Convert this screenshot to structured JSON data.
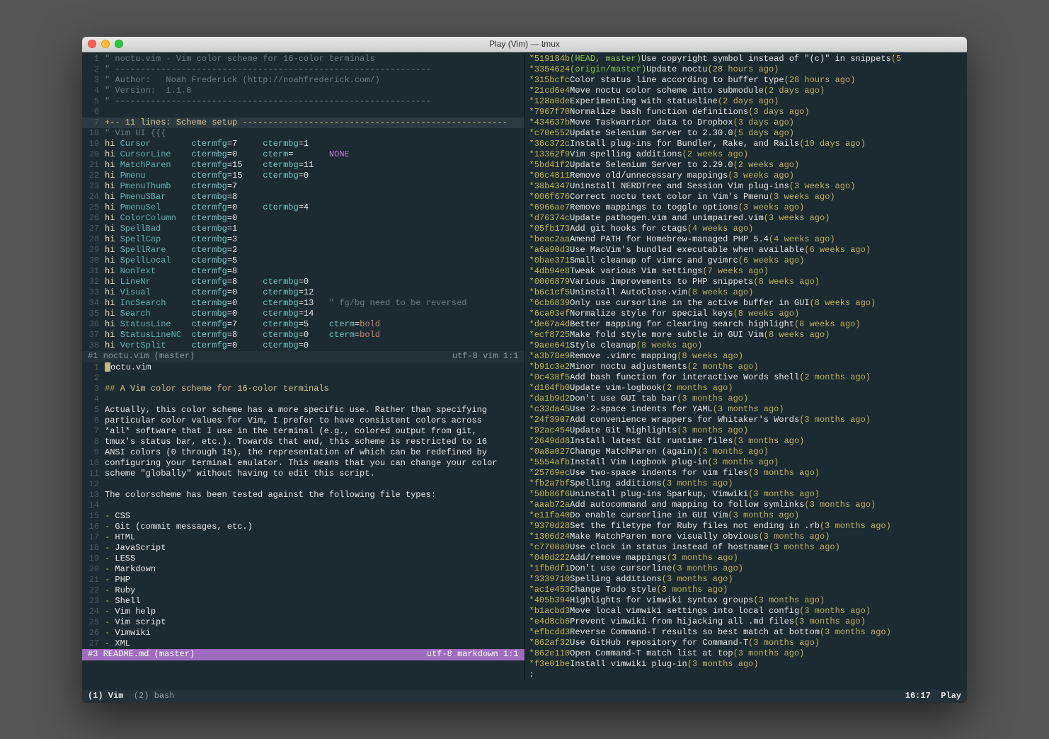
{
  "window_title": "Play (Vim) — tmux",
  "vim_top": {
    "header_lines": [
      {
        "n": "1",
        "comment": "\" noctu.vim - Vim color scheme for 16-color terminals"
      },
      {
        "n": "2",
        "comment": "\" --------------------------------------------------------------"
      },
      {
        "n": "3",
        "comment": "\" Author:   Noah Frederick (http://noahfrederick.com/)"
      },
      {
        "n": "4",
        "comment": "\" Version:  1.1.0"
      },
      {
        "n": "5",
        "comment": "\" --------------------------------------------------------------"
      },
      {
        "n": "6",
        "comment": ""
      }
    ],
    "fold": {
      "n": "7",
      "text": "+-- 11 lines: Scheme setup ----------------------------------------------------"
    },
    "section": {
      "n": "18",
      "text": "\" Vim UI {{{"
    },
    "hi_lines": [
      {
        "n": "19",
        "name": "Cursor",
        "a": "ctermfg=7",
        "b": "ctermbg=1",
        "c": ""
      },
      {
        "n": "20",
        "name": "CursorLine",
        "a": "ctermbg=0",
        "b": "cterm=",
        "c": "NONE"
      },
      {
        "n": "21",
        "name": "MatchParen",
        "a": "ctermfg=15",
        "b": "ctermbg=11",
        "c": ""
      },
      {
        "n": "22",
        "name": "Pmenu",
        "a": "ctermfg=15",
        "b": "ctermbg=0",
        "c": ""
      },
      {
        "n": "23",
        "name": "PmenuThumb",
        "a": "ctermbg=7",
        "b": "",
        "c": ""
      },
      {
        "n": "24",
        "name": "PmenuSBar",
        "a": "ctermbg=8",
        "b": "",
        "c": ""
      },
      {
        "n": "25",
        "name": "PmenuSel",
        "a": "ctermfg=0",
        "b": "ctermbg=4",
        "c": ""
      },
      {
        "n": "26",
        "name": "ColorColumn",
        "a": "ctermbg=0",
        "b": "",
        "c": ""
      },
      {
        "n": "27",
        "name": "SpellBad",
        "a": "ctermbg=1",
        "b": "",
        "c": ""
      },
      {
        "n": "28",
        "name": "SpellCap",
        "a": "ctermbg=3",
        "b": "",
        "c": ""
      },
      {
        "n": "29",
        "name": "SpellRare",
        "a": "ctermbg=2",
        "b": "",
        "c": ""
      },
      {
        "n": "30",
        "name": "SpellLocal",
        "a": "ctermbg=5",
        "b": "",
        "c": ""
      },
      {
        "n": "31",
        "name": "NonText",
        "a": "ctermfg=8",
        "b": "",
        "c": ""
      },
      {
        "n": "32",
        "name": "LineNr",
        "a": "ctermfg=8",
        "b": "ctermbg=0",
        "c": ""
      },
      {
        "n": "33",
        "name": "Visual",
        "a": "ctermfg=0",
        "b": "ctermbg=12",
        "c": ""
      },
      {
        "n": "34",
        "name": "IncSearch",
        "a": "ctermbg=0",
        "b": "ctermbg=13",
        "c": "\" fg/bg need to be reversed"
      },
      {
        "n": "35",
        "name": "Search",
        "a": "ctermbg=0",
        "b": "ctermbg=14",
        "c": ""
      },
      {
        "n": "36",
        "name": "StatusLine",
        "a": "ctermfg=7",
        "b": "ctermbg=5",
        "c": "cterm=bold"
      },
      {
        "n": "37",
        "name": "StatusLineNC",
        "a": "ctermfg=8",
        "b": "ctermbg=0",
        "c": "cterm=bold"
      },
      {
        "n": "38",
        "name": "VertSplit",
        "a": "ctermfg=0",
        "b": "ctermbg=0",
        "c": ""
      }
    ],
    "status": {
      "left": "#1   noctu.vim (master)",
      "right": "utf-8 vim     1:1"
    }
  },
  "vim_bottom": {
    "lines": [
      {
        "n": "1",
        "t": "noctu.vim",
        "cursor": true
      },
      {
        "n": "2",
        "t": ""
      },
      {
        "n": "3",
        "t": "## A Vim color scheme for 16-color terminals",
        "head": true
      },
      {
        "n": "4",
        "t": ""
      },
      {
        "n": "5",
        "t": "Actually, this color scheme has a more specific use. Rather than specifying"
      },
      {
        "n": "6",
        "t": "particular color values for Vim, I prefer to have consistent colors across"
      },
      {
        "n": "7",
        "t": "*all* software that I use in the terminal (e.g., colored output from git,"
      },
      {
        "n": "8",
        "t": "tmux's status bar, etc.). Towards that end, this scheme is restricted to 16"
      },
      {
        "n": "9",
        "t": "ANSI colors (0 through 15), the representation of which can be redefined by"
      },
      {
        "n": "10",
        "t": "configuring your terminal emulator. This means that you can change your color"
      },
      {
        "n": "11",
        "t": "scheme \"globally\" without having to edit this script."
      },
      {
        "n": "12",
        "t": ""
      },
      {
        "n": "13",
        "t": "The colorscheme has been tested against the following file types:"
      },
      {
        "n": "14",
        "t": ""
      },
      {
        "n": "15",
        "t": "- CSS",
        "li": true
      },
      {
        "n": "16",
        "t": "- Git (commit messages, etc.)",
        "li": true
      },
      {
        "n": "17",
        "t": "- HTML",
        "li": true
      },
      {
        "n": "18",
        "t": "- JavaScript",
        "li": true
      },
      {
        "n": "19",
        "t": "- LESS",
        "li": true
      },
      {
        "n": "20",
        "t": "- Markdown",
        "li": true
      },
      {
        "n": "21",
        "t": "- PHP",
        "li": true
      },
      {
        "n": "22",
        "t": "- Ruby",
        "li": true
      },
      {
        "n": "23",
        "t": "- Shell",
        "li": true
      },
      {
        "n": "24",
        "t": "- Vim help",
        "li": true
      },
      {
        "n": "25",
        "t": "- Vim script",
        "li": true
      },
      {
        "n": "26",
        "t": "- Vimwiki",
        "li": true
      },
      {
        "n": "27",
        "t": "- XML",
        "li": true
      }
    ],
    "status": {
      "left": "#3   README.md (master)",
      "right": "utf-8 markdown     1:1"
    }
  },
  "gitlog": [
    {
      "h": "519184b",
      "ref": "(HEAD, master)",
      "m": "Use copyright symbol instead of \"(c)\" in snippets",
      "a": "(5"
    },
    {
      "h": "3354624",
      "ref": "(origin/master)",
      "m": "Update noctu",
      "a": "(28 hours ago)"
    },
    {
      "h": "315bcfc",
      "m": "Color status line according to buffer type",
      "a": "(28 hours ago)"
    },
    {
      "h": "21cd6e4",
      "m": "Move noctu color scheme into submodule",
      "a": "(2 days ago)"
    },
    {
      "h": "128a0de",
      "m": "Experimenting with statusline",
      "a": "(2 days ago)"
    },
    {
      "h": "7967f70",
      "m": "Normalize bash function definitions",
      "a": "(3 days ago)"
    },
    {
      "h": "434637b",
      "m": "Move Taskwarrior data to Dropbox",
      "a": "(3 days ago)"
    },
    {
      "h": "c70e552",
      "m": "Update Selenium Server to 2.30.0",
      "a": "(5 days ago)"
    },
    {
      "h": "36c372c",
      "m": "Install plug-ins for Bundler, Rake, and Rails",
      "a": "(10 days ago)"
    },
    {
      "h": "13362f9",
      "m": "Vim spelling additions",
      "a": "(2 weeks ago)"
    },
    {
      "h": "5bd41f2",
      "m": "Update Selenium Server to 2.29.0",
      "a": "(2 weeks ago)"
    },
    {
      "h": "06c4811",
      "m": "Remove old/unnecessary mappings",
      "a": "(3 weeks ago)"
    },
    {
      "h": "38b4347",
      "m": "Uninstall NERDTree and Session Vim plug-ins",
      "a": "(3 weeks ago)"
    },
    {
      "h": "006f676",
      "m": "Correct noctu text color in Vim's Pmenu",
      "a": "(3 weeks ago)"
    },
    {
      "h": "6966ae7",
      "m": "Remove mappings to toggle options",
      "a": "(3 weeks ago)"
    },
    {
      "h": "d76374c",
      "m": "Update pathogen.vim and unimpaired.vim",
      "a": "(3 weeks ago)"
    },
    {
      "h": "05fb173",
      "m": "Add git hooks for ctags",
      "a": "(4 weeks ago)"
    },
    {
      "h": "beac2aa",
      "m": "Amend PATH for Homebrew-managed PHP 5.4",
      "a": "(4 weeks ago)"
    },
    {
      "h": "a6a90d3",
      "m": "Use MacVim's bundled executable when available",
      "a": "(6 weeks ago)"
    },
    {
      "h": "0bae371",
      "m": "Small cleanup of vimrc and gvimrc",
      "a": "(6 weeks ago)"
    },
    {
      "h": "4db94e8",
      "m": "Tweak various Vim settings",
      "a": "(7 weeks ago)"
    },
    {
      "h": "0006879",
      "m": "Various improvements to PHP snippets",
      "a": "(8 weeks ago)"
    },
    {
      "h": "b6c1cf5",
      "m": "Uninstall AutoClose.vim",
      "a": "(8 weeks ago)"
    },
    {
      "h": "6cb6839",
      "m": "Only use cursorline in the active buffer in GUI",
      "a": "(8 weeks ago)"
    },
    {
      "h": "6ca03ef",
      "m": "Normalize style for special keys",
      "a": "(8 weeks ago)"
    },
    {
      "h": "de67a4d",
      "m": "Better mapping for clearing search highlight",
      "a": "(8 weeks ago)"
    },
    {
      "h": "ecf8725",
      "m": "Make fold style more subtle in GUI Vim",
      "a": "(8 weeks ago)"
    },
    {
      "h": "9aee641",
      "m": "Style cleanup",
      "a": "(8 weeks ago)"
    },
    {
      "h": "a3b78e9",
      "m": "Remove .vimrc mapping",
      "a": "(8 weeks ago)"
    },
    {
      "h": "b91c3e2",
      "m": "Minor noctu adjustments",
      "a": "(2 months ago)"
    },
    {
      "h": "0c438f5",
      "m": "Add bash function for interactive Words shell",
      "a": "(2 months ago)"
    },
    {
      "h": "d164fb0",
      "m": "Update vim-logbook",
      "a": "(2 months ago)"
    },
    {
      "h": "da1b9d2",
      "m": "Don't use GUI tab bar",
      "a": "(3 months ago)"
    },
    {
      "h": "c33da45",
      "m": "Use 2-space indents for YAML",
      "a": "(3 months ago)"
    },
    {
      "h": "24f3907",
      "m": "Add convenience wrappers for Whitaker's Words",
      "a": "(3 months ago)"
    },
    {
      "h": "92ac454",
      "m": "Update Git highlights",
      "a": "(3 months ago)"
    },
    {
      "h": "2649dd8",
      "m": "Install latest Git runtime files",
      "a": "(3 months ago)"
    },
    {
      "h": "0a8a027",
      "m": "Change MatchParen (again)",
      "a": "(3 months ago)"
    },
    {
      "h": "5554afb",
      "m": "Install Vim Logbook plug-in",
      "a": "(3 months ago)"
    },
    {
      "h": "25769ec",
      "m": "Use two-space indents for vim files",
      "a": "(3 months ago)"
    },
    {
      "h": "fb2a7bf",
      "m": "Spelling additions",
      "a": "(3 months ago)"
    },
    {
      "h": "50b86f6",
      "m": "Uninstall plug-ins Sparkup, Vimwiki",
      "a": "(3 months ago)"
    },
    {
      "h": "aaab72a",
      "m": "Add autocommand and mapping to follow symlinks",
      "a": "(3 months ago)"
    },
    {
      "h": "e11fa40",
      "m": "Do enable cursorline in GUI Vim",
      "a": "(3 months ago)"
    },
    {
      "h": "9370d28",
      "m": "Set the filetype for Ruby files not ending in .rb",
      "a": "(3 months ago)"
    },
    {
      "h": "1306d24",
      "m": "Make MatchParen more visually obvious",
      "a": "(3 months ago)"
    },
    {
      "h": "c7708a9",
      "m": "Use clock in status instead of hostname",
      "a": "(3 months ago)"
    },
    {
      "h": "040d222",
      "m": "Add/remove mappings",
      "a": "(3 months ago)"
    },
    {
      "h": "1fb0df1",
      "m": "Don't use cursorline",
      "a": "(3 months ago)"
    },
    {
      "h": "3339710",
      "m": "Spelling additions",
      "a": "(3 months ago)"
    },
    {
      "h": "ac1e453",
      "m": "Change Todo style",
      "a": "(3 months ago)"
    },
    {
      "h": "405b394",
      "m": "Highlights for vimwiki syntax groups",
      "a": "(3 months ago)"
    },
    {
      "h": "b1acbd3",
      "m": "Move local vimwiki settings into local config",
      "a": "(3 months ago)"
    },
    {
      "h": "e4d8cb6",
      "m": "Prevent vimwiki from hijacking all .md files",
      "a": "(3 months ago)"
    },
    {
      "h": "efbcdd3",
      "m": "Reverse Command-T results so best match at bottom",
      "a": "(3 months ago)"
    },
    {
      "h": "862af32",
      "m": "Use GitHub repository for Command-T",
      "a": "(3 months ago)"
    },
    {
      "h": "862e110",
      "m": "Open Command-T match list at top",
      "a": "(3 months ago)"
    },
    {
      "h": "f3e01be",
      "m": "Install vimwiki plug-in",
      "a": "(3 months ago)"
    }
  ],
  "git_prompt": ":",
  "tmux": {
    "w1": "(1) Vim",
    "w2": "(2) bash",
    "time": "16:17",
    "session": "Play"
  }
}
